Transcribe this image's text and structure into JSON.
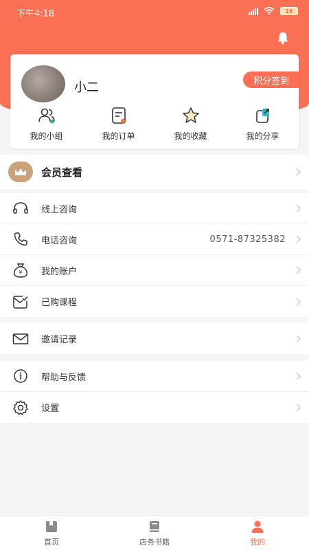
{
  "status_bar": {
    "time": "下午4:18",
    "battery": "19"
  },
  "profile": {
    "name": "小二",
    "signin_label": "积分签到"
  },
  "quick_actions": [
    {
      "label": "我的小组",
      "icon": "group-icon"
    },
    {
      "label": "我的订单",
      "icon": "order-icon"
    },
    {
      "label": "我的收藏",
      "icon": "star-icon"
    },
    {
      "label": "我的分享",
      "icon": "share-icon"
    }
  ],
  "vip": {
    "label": "会员查看",
    "icon": "crown-icon"
  },
  "menu": {
    "online_consult": "线上咨询",
    "phone_consult": "电话咨询",
    "phone_number": "0571-87325382",
    "account": "我的账户",
    "courses": "已购课程",
    "invites": "邀请记录",
    "help": "帮助与反馈",
    "settings": "设置"
  },
  "tabbar": {
    "items": [
      {
        "label": "首页",
        "icon": "home-icon"
      },
      {
        "label": "店务书籍",
        "icon": "book-icon"
      },
      {
        "label": "我的",
        "icon": "person-icon"
      }
    ],
    "active_index": 2
  },
  "colors": {
    "accent": "#fb6f55",
    "vip_gold": "#c9a27a",
    "chevron": "#bbbbbb"
  }
}
